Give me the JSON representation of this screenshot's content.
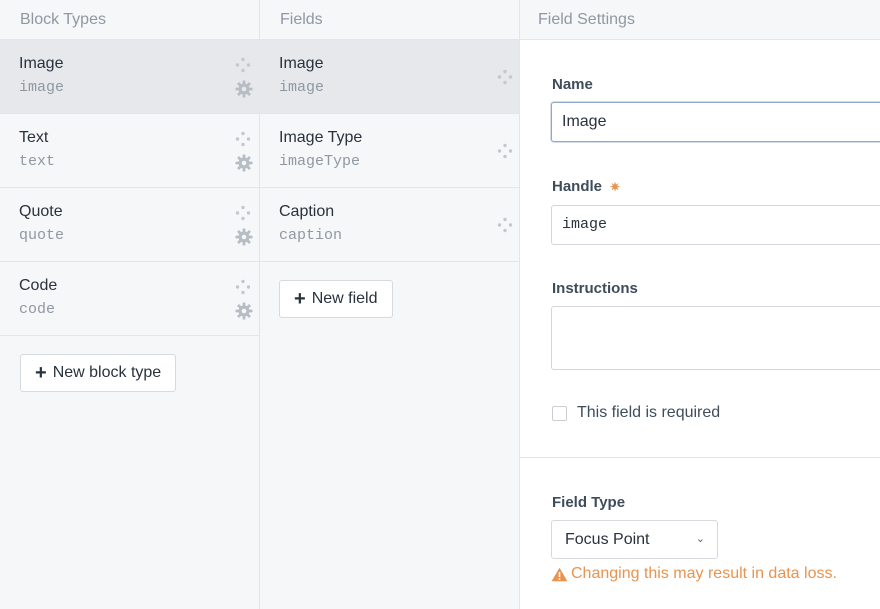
{
  "block_types": {
    "header": "Block Types",
    "items": [
      {
        "name": "Image",
        "handle": "image"
      },
      {
        "name": "Text",
        "handle": "text"
      },
      {
        "name": "Quote",
        "handle": "quote"
      },
      {
        "name": "Code",
        "handle": "code"
      }
    ],
    "new_button": "New block type"
  },
  "fields": {
    "header": "Fields",
    "items": [
      {
        "name": "Image",
        "handle": "image"
      },
      {
        "name": "Image Type",
        "handle": "imageType"
      },
      {
        "name": "Caption",
        "handle": "caption"
      }
    ],
    "new_button": "New field"
  },
  "field_settings": {
    "header": "Field Settings",
    "name_label": "Name",
    "name_value": "Image",
    "handle_label": "Handle",
    "handle_value": "image",
    "instructions_label": "Instructions",
    "instructions_value": "",
    "required_label": "This field is required",
    "field_type_label": "Field Type",
    "field_type_value": "Focus Point",
    "warning": "Changing this may result in data loss."
  },
  "colors": {
    "warning": "#e8934f",
    "selected_row": "#e6e8eb",
    "panel_bg": "#f6f7f8"
  }
}
